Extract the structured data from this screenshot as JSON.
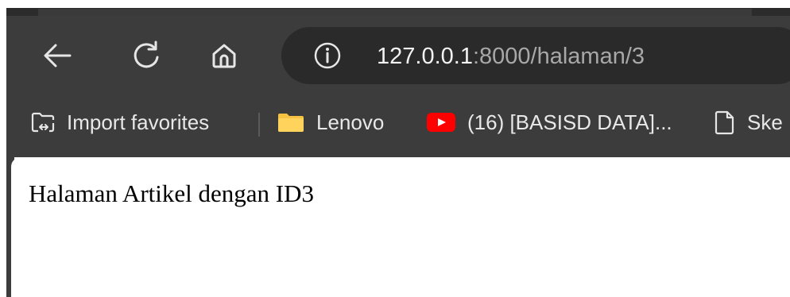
{
  "browser": {
    "nav": {
      "back_icon": "arrow-left-icon",
      "reload_icon": "reload-icon",
      "home_icon": "home-icon"
    },
    "address_bar": {
      "info_icon": "info-icon",
      "host": "127.0.0.1",
      "port_path": ":8000/halaman/3"
    },
    "bookmarks": [
      {
        "label": "Import favorites",
        "icon": "import-favorites-icon"
      },
      {
        "label": "Lenovo",
        "icon": "folder-icon"
      },
      {
        "label": "(16) [BASISD DATA]...",
        "icon": "youtube-icon"
      },
      {
        "label": "Ske",
        "icon": "document-icon"
      }
    ]
  },
  "page": {
    "text": "Halaman Artikel dengan ID3"
  },
  "colors": {
    "chrome_bg": "#3c3c3c",
    "omnibox_bg": "#2a2a2a",
    "folder_yellow": "#f5c242",
    "youtube_red": "#ff0000"
  }
}
